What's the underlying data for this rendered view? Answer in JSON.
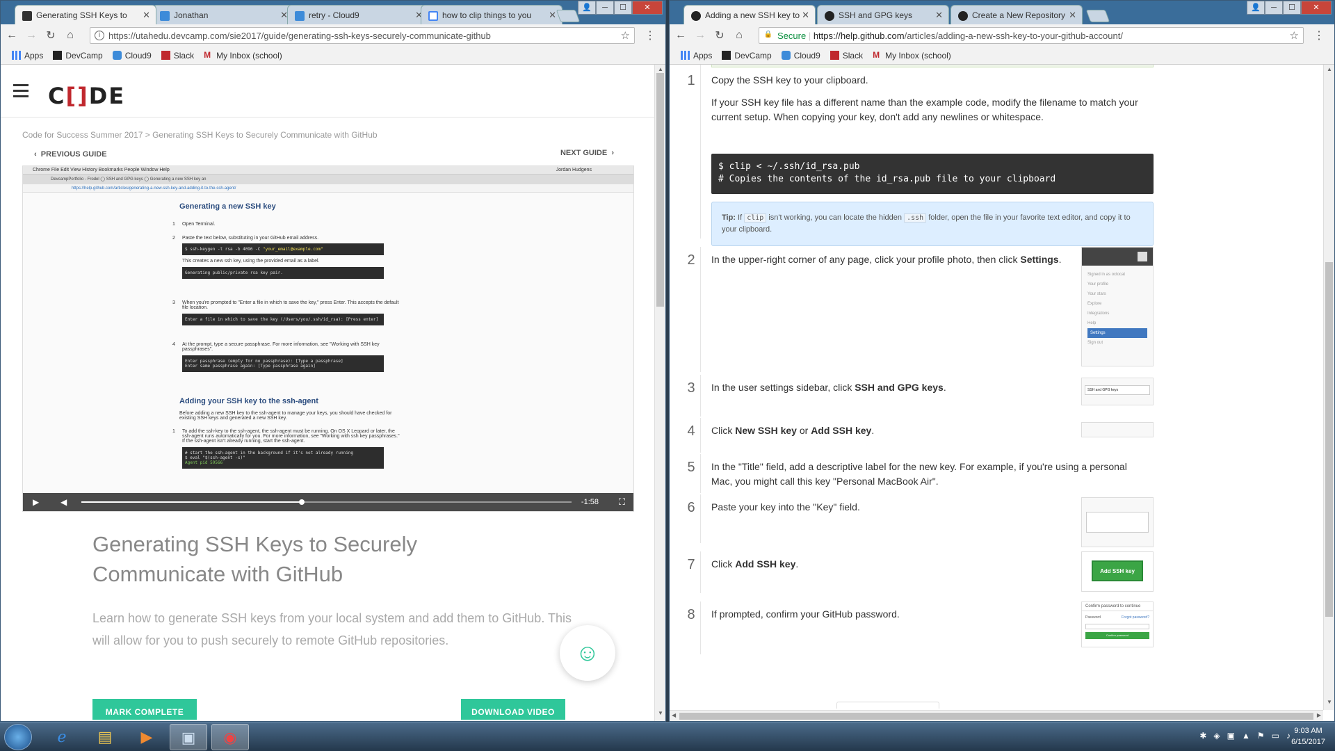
{
  "left_window": {
    "tabs": [
      {
        "title": "Generating SSH Keys to",
        "active": true
      },
      {
        "title": "Jonathan",
        "active": false
      },
      {
        "title": "retry - Cloud9",
        "active": false
      },
      {
        "title": "how to clip things to you",
        "active": false
      }
    ],
    "url": "https://utahedu.devcamp.com/sie2017/guide/generating-ssh-keys-securely-communicate-github",
    "bookmarks": [
      "Apps",
      "DevCamp",
      "Cloud9",
      "Slack",
      "My Inbox (school)"
    ],
    "logo": {
      "pre": "C",
      "mid": "[]",
      "post": "DE"
    },
    "breadcrumb": "Code for Success Summer 2017 > Generating SSH Keys to Securely Communicate with GitHub",
    "prev_guide": "PREVIOUS GUIDE",
    "next_guide": "NEXT GUIDE",
    "video": {
      "mac_menu": "Chrome   File   Edit   View   History   Bookmarks   People   Window   Help",
      "mac_right": "Jordan Hudgens",
      "mac_tabs": "DevcampPortfolio - Frodel   ◯ SSH and GPG keys   ◯ Generating a new SSH key an",
      "mac_url": "https://help.github.com/articles/generating-a-new-ssh-key-and-adding-it-to-the-ssh-agent/",
      "h1": "Generating a new SSH key",
      "s1": "Open Terminal.",
      "s2": "Paste the text below, substituting in your GitHub email address.",
      "code1": "$ ssh-keygen -t rsa -b 4096 -C ",
      "code1_em": "\"your_email@example.com\"",
      "s2b": "This creates a new ssh key, using the provided email as a label.",
      "code2": "Generating public/private rsa key pair.",
      "s3": "When you're prompted to \"Enter a file in which to save the key,\" press Enter. This accepts the default file location.",
      "code3": "Enter a file in which to save the key (/Users/you/.ssh/id_rsa): [Press enter]",
      "s4": "At the prompt, type a secure passphrase. For more information, see \"Working with SSH key passphrases\".",
      "code4a": "Enter passphrase (empty for no passphrase): [Type a passphrase]",
      "code4b": "Enter same passphrase again: [Type passphrase again]",
      "h2": "Adding your SSH key to the ssh-agent",
      "p2": "Before adding a new SSH key to the ssh-agent to manage your keys, you should have checked for existing SSH keys and generated a new SSH key.",
      "s5": "To add the ssh-key to the ssh-agent, the ssh-agent must be running. On OS X Leopard or later, the ssh-agent runs automatically for you. For more information, see \"Working with ssh key passphrases.\" If the ssh-agent isn't already running, start the ssh-agent.",
      "code5a": "# start the ssh-agent in the background if it's not already running",
      "code5b": "$ eval \"$(ssh-agent -s)\"",
      "code5c": "Agent pid 59566",
      "n1": "1",
      "n2": "2",
      "n3": "3",
      "n4": "4",
      "time": "-1:58",
      "progress": 0.45
    },
    "title": "Generating SSH Keys to Securely Communicate with GitHub",
    "description": "Learn how to generate SSH keys from your local system and add them to GitHub. This will allow for you to push securely to remote GitHub repositories.",
    "mark_complete": "MARK COMPLETE",
    "download_video": "DOWNLOAD VIDEO"
  },
  "right_window": {
    "tabs": [
      {
        "title": "Adding a new SSH key to",
        "active": true
      },
      {
        "title": "SSH and GPG keys",
        "active": false
      },
      {
        "title": "Create a New Repository",
        "active": false
      }
    ],
    "secure": "Secure",
    "url_host": "https://help.github.com",
    "url_path": "/articles/adding-a-new-ssh-key-to-your-github-account/",
    "bookmarks": [
      "Apps",
      "DevCamp",
      "Cloud9",
      "Slack",
      "My Inbox (school)"
    ],
    "steps": [
      {
        "n": "1",
        "text": "Copy the SSH key to your clipboard."
      },
      {
        "n": "2",
        "text_pre": "In the upper-right corner of any page, click your profile photo, then click ",
        "bold": "Settings",
        "text_post": "."
      },
      {
        "n": "3",
        "text_pre": "In the user settings sidebar, click ",
        "bold": "SSH and GPG keys",
        "text_post": "."
      },
      {
        "n": "4",
        "text_pre": "Click ",
        "bold": "New SSH key",
        "text_mid": " or ",
        "bold2": "Add SSH key",
        "text_post": "."
      },
      {
        "n": "5",
        "text": "In the \"Title\" field, add a descriptive label for the new key. For example, if you're using a personal Mac, you might call this key \"Personal MacBook Air\"."
      },
      {
        "n": "6",
        "text": "Paste your key into the \"Key\" field."
      },
      {
        "n": "7",
        "text_pre": "Click ",
        "bold": "Add SSH key",
        "text_post": "."
      },
      {
        "n": "8",
        "text": "If prompted, confirm your GitHub password."
      }
    ],
    "step1_extra": "If your SSH key file has a different name than the example code, modify the filename to match your current setup. When copying your key, don't add any newlines or whitespace.",
    "code_line1": "$ clip < ~/.ssh/id_rsa.pub",
    "code_line2": "# Copies the contents of the id_rsa.pub file to your clipboard",
    "tip": {
      "label": "Tip:",
      "pre": " If ",
      "code1": "clip",
      "mid": " isn't working, you can locate the hidden ",
      "code2": ".ssh",
      "post": " folder, open the file in your favorite text editor, and copy it to your clipboard."
    },
    "thumb2": {
      "items": [
        "Signed in as octocat",
        "Your profile",
        "Your stars",
        "Explore",
        "Integrations",
        "Help",
        "Settings",
        "Sign out"
      ]
    },
    "thumb3": "SSH and GPG keys",
    "thumb7": "Add SSH key",
    "thumb8": {
      "title": "Confirm password to continue",
      "label": "Password",
      "link": "Forgot password?",
      "button": "Confirm password"
    }
  },
  "taskbar": {
    "time": "9:03 AM",
    "date": "6/15/2017"
  }
}
